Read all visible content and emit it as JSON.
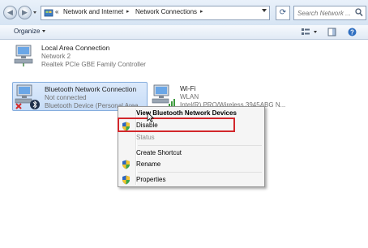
{
  "address_bar": {
    "overflow_marker": "«",
    "breadcrumb": [
      "Network and Internet",
      "Network Connections"
    ],
    "separator": "▸"
  },
  "search": {
    "placeholder": "Search Network ..."
  },
  "toolbar": {
    "organize_label": "Organize"
  },
  "connections": [
    {
      "name": "Local Area Connection",
      "status": "Network  2",
      "device": "Realtek PCIe GBE Family Controller"
    },
    {
      "name": "Bluetooth Network Connection",
      "status": "Not connected",
      "device": "Bluetooth Device (Personal Area ..."
    },
    {
      "name": "Wi-Fi",
      "status": "WLAN",
      "device": "Intel(R) PRO/Wireless 3945ABG N..."
    }
  ],
  "context_menu": {
    "items": [
      {
        "label": "View Bluetooth Network Devices",
        "style": "bold"
      },
      {
        "label": "Disable",
        "icon": "uac-shield-icon",
        "highlighted": true
      },
      {
        "label": "Status",
        "style": "disabled"
      },
      {
        "label": "Create Shortcut"
      },
      {
        "label": "Rename",
        "icon": "uac-shield-icon"
      },
      {
        "label": "Properties",
        "icon": "uac-shield-icon"
      }
    ]
  },
  "colors": {
    "highlight_box": "#d2272c",
    "selection_bg": "#c6dcf7",
    "window_bg": "#ffffff"
  }
}
